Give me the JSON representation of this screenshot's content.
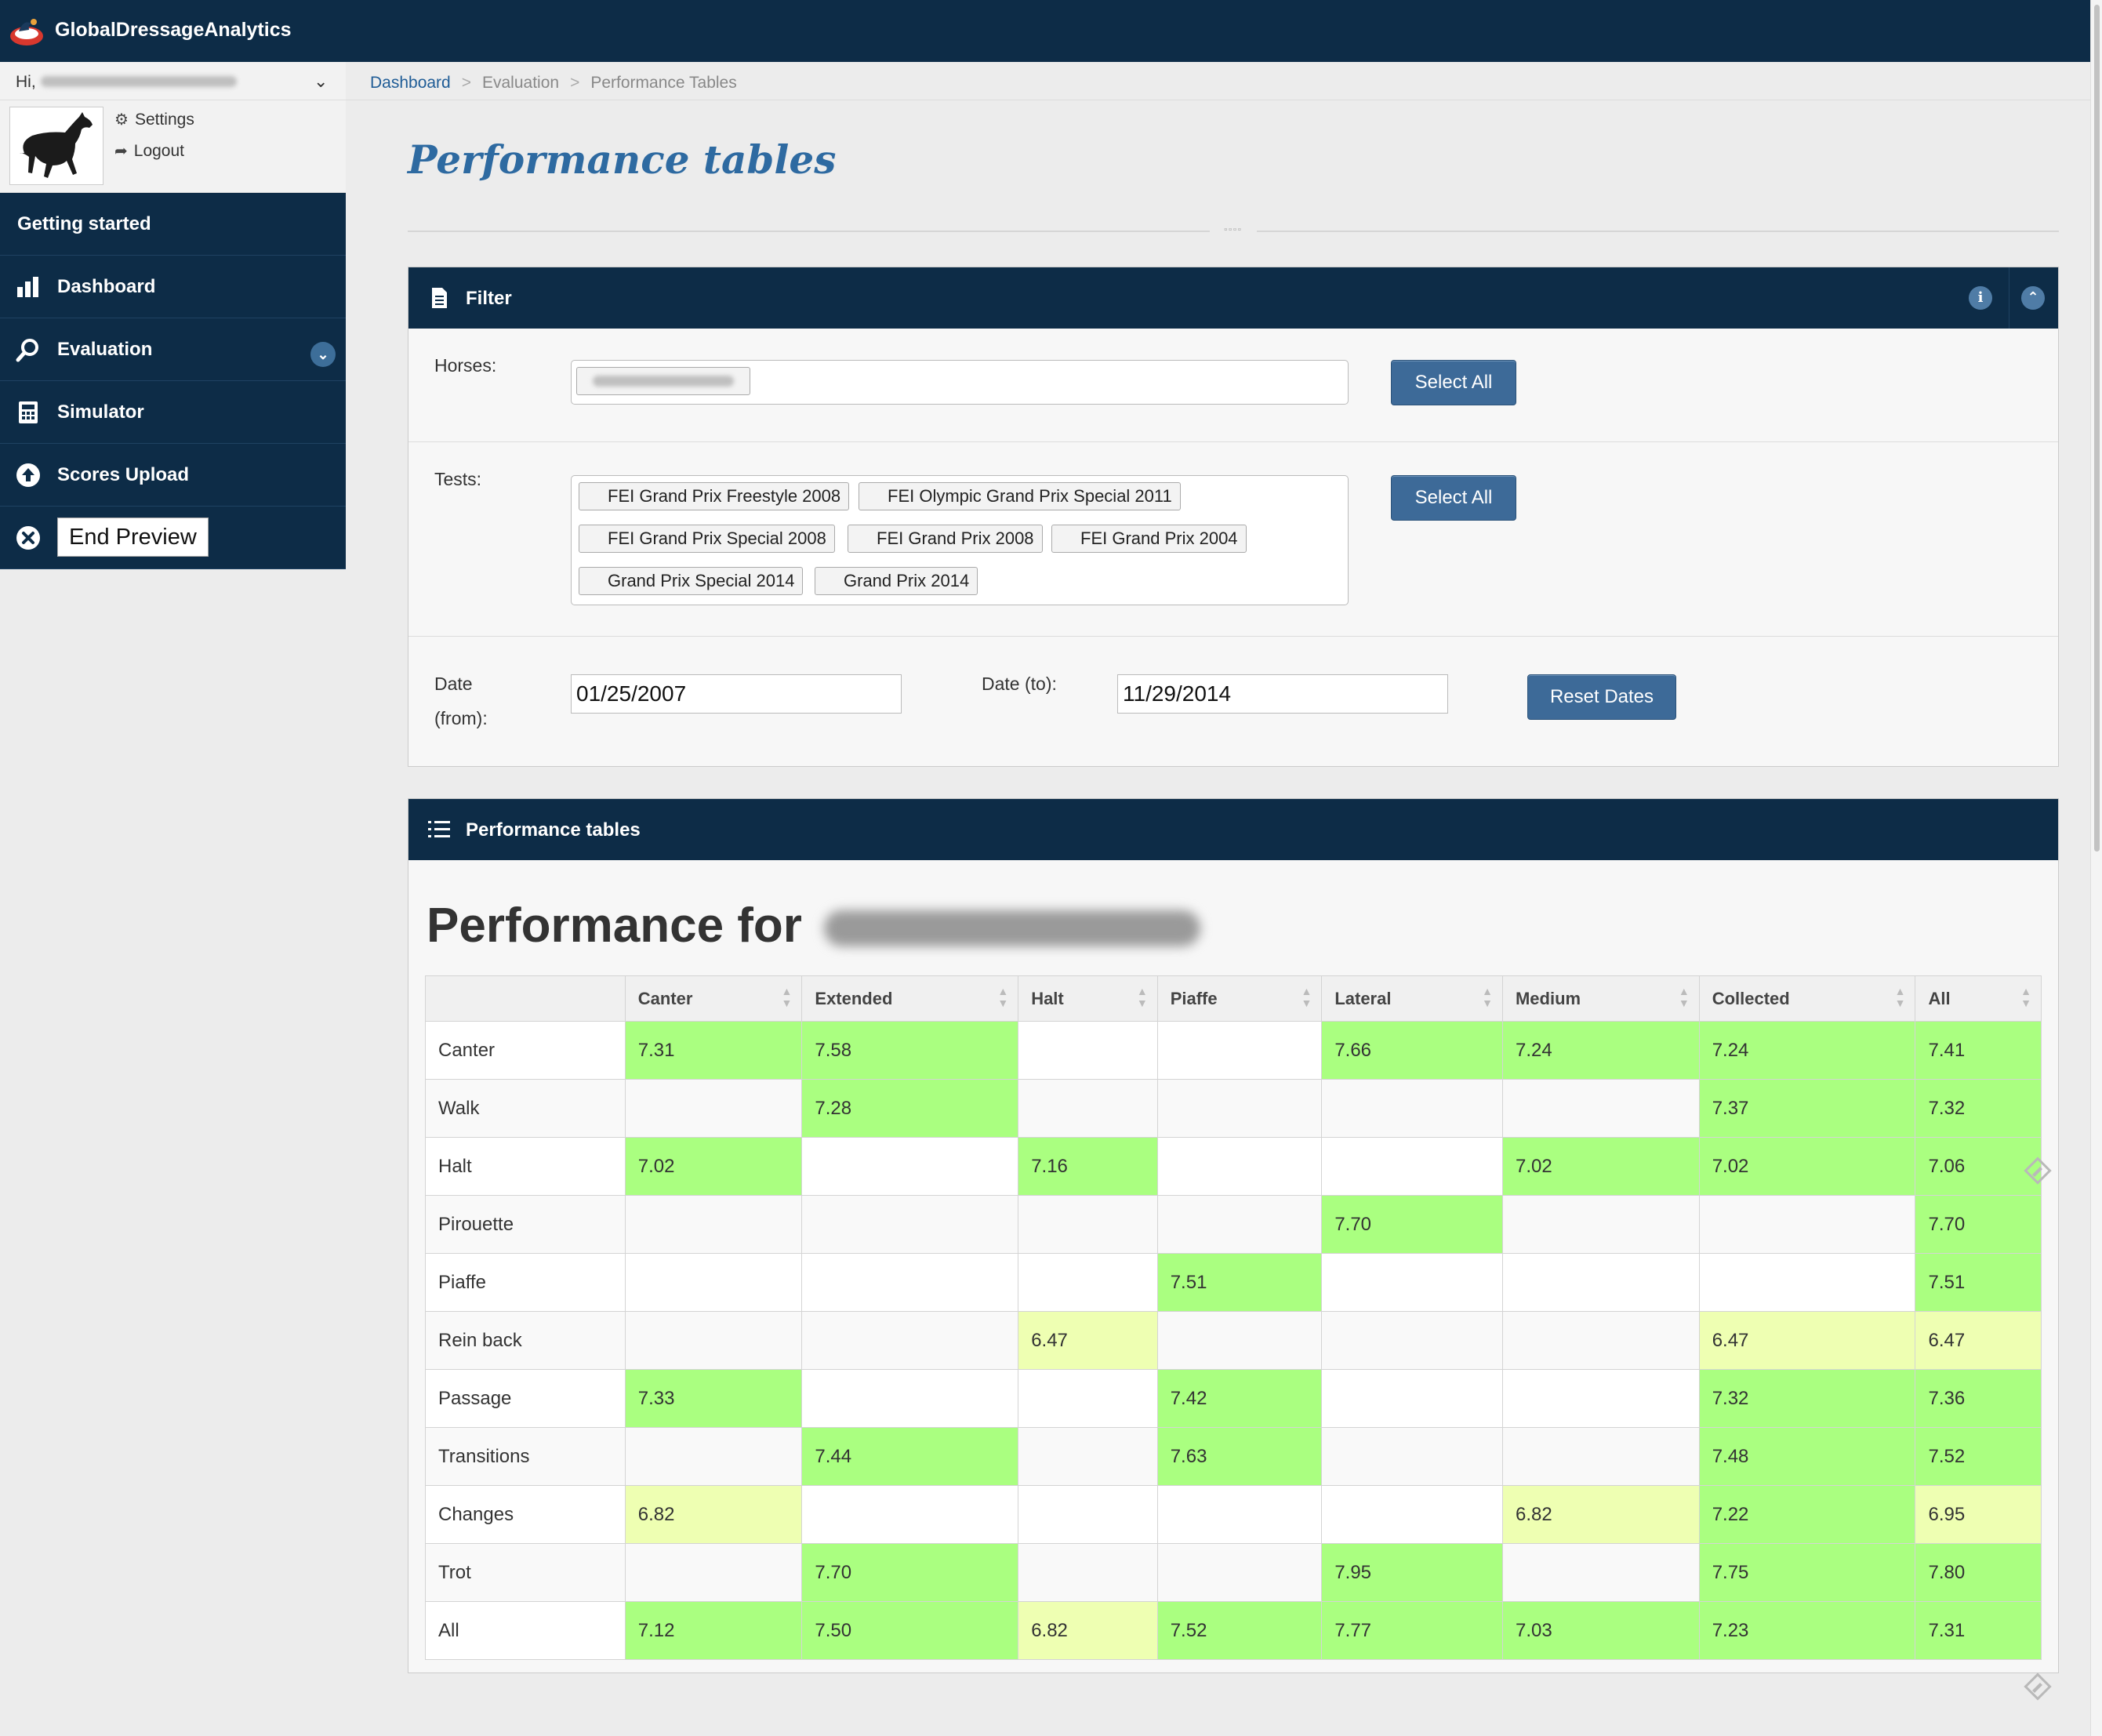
{
  "app": {
    "brand": "GlobalDressageAnalytics"
  },
  "user": {
    "greeting": "Hi,",
    "settings": "Settings",
    "logout": "Logout"
  },
  "nav": {
    "getting_started": "Getting started",
    "dashboard": "Dashboard",
    "evaluation": "Evaluation",
    "simulator": "Simulator",
    "scores_upload": "Scores Upload",
    "end_preview": "End Preview"
  },
  "breadcrumb": {
    "home": "Dashboard",
    "middle": "Evaluation",
    "current": "Performance Tables",
    "separator": ">"
  },
  "page": {
    "title": "Performance tables"
  },
  "filter": {
    "title": "Filter",
    "horses_label": "Horses:",
    "select_all": "Select All",
    "tests_label": "Tests:",
    "tests": [
      "FEI Grand Prix Freestyle 2008",
      "FEI Olympic Grand Prix Special 2011",
      "FEI Grand Prix Special 2008",
      "FEI Grand Prix 2008",
      "FEI Grand Prix 2004",
      "Grand Prix Special 2014",
      "Grand Prix 2014"
    ],
    "date_from_label_1": "Date",
    "date_from_label_2": "(from):",
    "date_from": "01/25/2007",
    "date_to_label": "Date (to):",
    "date_to": "11/29/2014",
    "reset_dates": "Reset Dates"
  },
  "performance": {
    "panel_title": "Performance tables",
    "heading": "Performance for",
    "columns": [
      "",
      "Canter",
      "Extended",
      "Halt",
      "Piaffe",
      "Lateral",
      "Medium",
      "Collected",
      "All"
    ],
    "rows": [
      {
        "label": "Canter",
        "cells": [
          "7.31",
          "7.58",
          "",
          "",
          "7.66",
          "7.24",
          "7.24",
          "7.41"
        ],
        "levels": [
          "g",
          "g",
          "",
          "",
          "g",
          "g",
          "g",
          "g"
        ]
      },
      {
        "label": "Walk",
        "cells": [
          "",
          "7.28",
          "",
          "",
          "",
          "",
          "7.37",
          "7.32"
        ],
        "levels": [
          "",
          "g",
          "",
          "",
          "",
          "",
          "g",
          "g"
        ]
      },
      {
        "label": "Halt",
        "cells": [
          "7.02",
          "",
          "7.16",
          "",
          "",
          "7.02",
          "7.02",
          "7.06"
        ],
        "levels": [
          "g",
          "",
          "g",
          "",
          "",
          "g",
          "g",
          "g"
        ]
      },
      {
        "label": "Pirouette",
        "cells": [
          "",
          "",
          "",
          "",
          "7.70",
          "",
          "",
          "7.70"
        ],
        "levels": [
          "",
          "",
          "",
          "",
          "g",
          "",
          "",
          "g"
        ]
      },
      {
        "label": "Piaffe",
        "cells": [
          "",
          "",
          "",
          "7.51",
          "",
          "",
          "",
          "7.51"
        ],
        "levels": [
          "",
          "",
          "",
          "g",
          "",
          "",
          "",
          "g"
        ]
      },
      {
        "label": "Rein back",
        "cells": [
          "",
          "",
          "6.47",
          "",
          "",
          "",
          "6.47",
          "6.47"
        ],
        "levels": [
          "",
          "",
          "y",
          "",
          "",
          "",
          "y",
          "y"
        ]
      },
      {
        "label": "Passage",
        "cells": [
          "7.33",
          "",
          "",
          "7.42",
          "",
          "",
          "7.32",
          "7.36"
        ],
        "levels": [
          "g",
          "",
          "",
          "g",
          "",
          "",
          "g",
          "g"
        ]
      },
      {
        "label": "Transitions",
        "cells": [
          "",
          "7.44",
          "",
          "7.63",
          "",
          "",
          "7.48",
          "7.52"
        ],
        "levels": [
          "",
          "g",
          "",
          "g",
          "",
          "",
          "g",
          "g"
        ]
      },
      {
        "label": "Changes",
        "cells": [
          "6.82",
          "",
          "",
          "",
          "",
          "6.82",
          "7.22",
          "6.95"
        ],
        "levels": [
          "y",
          "",
          "",
          "",
          "",
          "y",
          "g",
          "y"
        ]
      },
      {
        "label": "Trot",
        "cells": [
          "",
          "7.70",
          "",
          "",
          "7.95",
          "",
          "7.75",
          "7.80"
        ],
        "levels": [
          "",
          "g",
          "",
          "",
          "g",
          "",
          "g",
          "g"
        ]
      },
      {
        "label": "All",
        "cells": [
          "7.12",
          "7.50",
          "6.82",
          "7.52",
          "7.77",
          "7.03",
          "7.23",
          "7.31"
        ],
        "levels": [
          "g",
          "g",
          "y",
          "g",
          "g",
          "g",
          "g",
          "g"
        ]
      }
    ]
  },
  "colors": {
    "navy": "#0d2c47",
    "good": "#aaff80",
    "fair": "#eeffb2",
    "button": "#3d6a98",
    "title": "#2e6aa1"
  }
}
